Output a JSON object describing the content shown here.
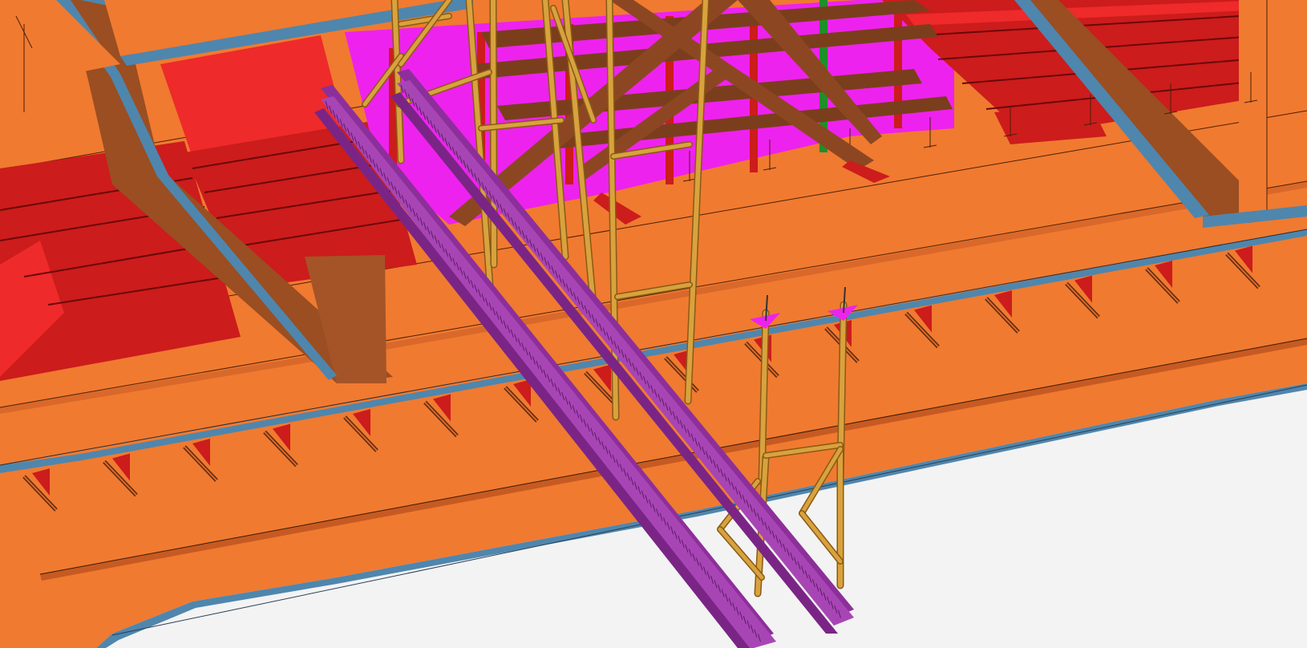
{
  "viewer": {
    "background_color": "#f3f3f3",
    "view_mode": "shaded-3d"
  },
  "palette": {
    "hull_orange": "#f07a30",
    "hull_orange_dark": "#d9682a",
    "frame_red": "#cc1c1c",
    "frame_red_bright": "#ee2a2a",
    "web_brown": "#9a4e22",
    "edge_blue": "#4f86ad",
    "bulkhead_magenta": "#ee22ee",
    "brace_brown": "#7b3e1c",
    "scaffold_tan": "#d8a23e",
    "beam_purple": "#a845b5",
    "pipe_green": "#1f8f2a"
  },
  "model": {
    "components": [
      {
        "id": "deck-plating",
        "color": "hull_orange"
      },
      {
        "id": "transverse-web-frames",
        "color": "web_brown"
      },
      {
        "id": "longitudinal-stiffeners",
        "color": "frame_red"
      },
      {
        "id": "edge-flanges",
        "color": "edge_blue"
      },
      {
        "id": "bulkhead",
        "color": "bulkhead_magenta"
      },
      {
        "id": "timber-bracing",
        "color": "brace_brown"
      },
      {
        "id": "support-legs",
        "color": "scaffold_tan"
      },
      {
        "id": "i-beams",
        "color": "beam_purple"
      },
      {
        "id": "vertical-pipe",
        "color": "pipe_green"
      }
    ]
  }
}
